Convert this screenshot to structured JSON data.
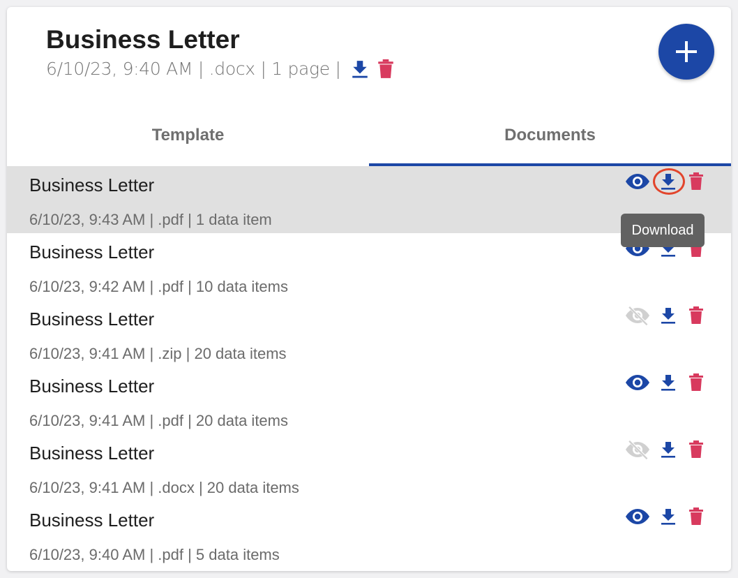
{
  "template": {
    "title": "Business Letter",
    "meta": "6/10/23, 9:40 AM | .docx | 1 page |",
    "download_icon": "download-icon",
    "delete_icon": "delete-icon"
  },
  "fab": {
    "icon": "plus-icon"
  },
  "tabs": [
    {
      "label": "Template",
      "active": false
    },
    {
      "label": "Documents",
      "active": true
    }
  ],
  "documents": [
    {
      "name": "Business Letter",
      "meta": "6/10/23, 9:43 AM | .pdf | 1 data item",
      "preview": true,
      "hovered": true
    },
    {
      "name": "Business Letter",
      "meta": "6/10/23, 9:42 AM | .pdf | 10 data items",
      "preview": true,
      "hovered": false
    },
    {
      "name": "Business Letter",
      "meta": "6/10/23, 9:41 AM | .zip | 20 data items",
      "preview": false,
      "hovered": false
    },
    {
      "name": "Business Letter",
      "meta": "6/10/23, 9:41 AM | .pdf | 20 data items",
      "preview": true,
      "hovered": false
    },
    {
      "name": "Business Letter",
      "meta": "6/10/23, 9:41 AM | .docx | 20 data items",
      "preview": false,
      "hovered": false
    },
    {
      "name": "Business Letter",
      "meta": "6/10/23, 9:40 AM | .pdf | 5 data items",
      "preview": true,
      "hovered": false
    }
  ],
  "tooltip": {
    "text": "Download"
  },
  "colors": {
    "primary": "#1c47a6",
    "danger": "#d83a5e",
    "disabled": "#d0d0d0",
    "hover_row": "#e0e0e0",
    "highlight": "#e2452c"
  }
}
